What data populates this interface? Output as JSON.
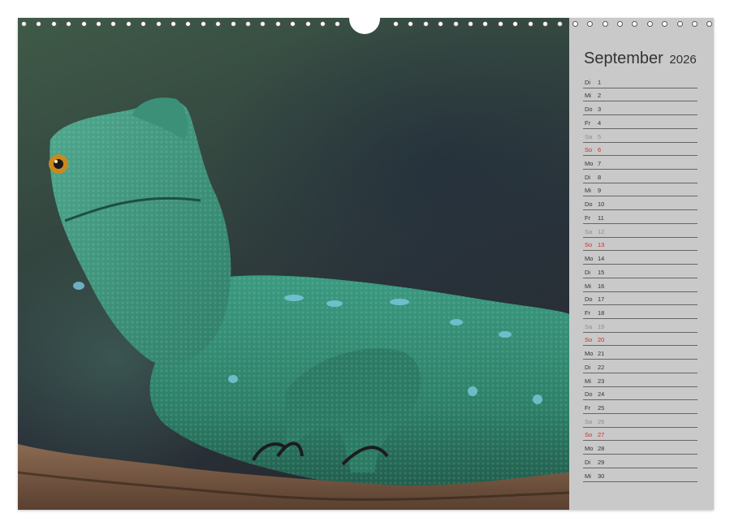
{
  "calendar": {
    "month": "September",
    "year": "2026",
    "days": [
      {
        "weekday": "Di",
        "day": "1",
        "type": "weekday"
      },
      {
        "weekday": "Mi",
        "day": "2",
        "type": "weekday"
      },
      {
        "weekday": "Do",
        "day": "3",
        "type": "weekday"
      },
      {
        "weekday": "Fr",
        "day": "4",
        "type": "weekday"
      },
      {
        "weekday": "Sa",
        "day": "5",
        "type": "sat"
      },
      {
        "weekday": "So",
        "day": "6",
        "type": "sun"
      },
      {
        "weekday": "Mo",
        "day": "7",
        "type": "weekday"
      },
      {
        "weekday": "Di",
        "day": "8",
        "type": "weekday"
      },
      {
        "weekday": "Mi",
        "day": "9",
        "type": "weekday"
      },
      {
        "weekday": "Do",
        "day": "10",
        "type": "weekday"
      },
      {
        "weekday": "Fr",
        "day": "11",
        "type": "weekday"
      },
      {
        "weekday": "Sa",
        "day": "12",
        "type": "sat"
      },
      {
        "weekday": "So",
        "day": "13",
        "type": "sun"
      },
      {
        "weekday": "Mo",
        "day": "14",
        "type": "weekday"
      },
      {
        "weekday": "Di",
        "day": "15",
        "type": "weekday"
      },
      {
        "weekday": "Mi",
        "day": "16",
        "type": "weekday"
      },
      {
        "weekday": "Do",
        "day": "17",
        "type": "weekday"
      },
      {
        "weekday": "Fr",
        "day": "18",
        "type": "weekday"
      },
      {
        "weekday": "Sa",
        "day": "19",
        "type": "sat"
      },
      {
        "weekday": "So",
        "day": "20",
        "type": "sun"
      },
      {
        "weekday": "Mo",
        "day": "21",
        "type": "weekday"
      },
      {
        "weekday": "Di",
        "day": "22",
        "type": "weekday"
      },
      {
        "weekday": "Mi",
        "day": "23",
        "type": "weekday"
      },
      {
        "weekday": "Do",
        "day": "24",
        "type": "weekday"
      },
      {
        "weekday": "Fr",
        "day": "25",
        "type": "weekday"
      },
      {
        "weekday": "Sa",
        "day": "26",
        "type": "sat"
      },
      {
        "weekday": "So",
        "day": "27",
        "type": "sun"
      },
      {
        "weekday": "Mo",
        "day": "28",
        "type": "weekday"
      },
      {
        "weekday": "Di",
        "day": "29",
        "type": "weekday"
      },
      {
        "weekday": "Mi",
        "day": "30",
        "type": "weekday"
      }
    ]
  },
  "photo": {
    "subject": "green-lizard-photo"
  },
  "colors": {
    "panel_background": "#c9c9c9",
    "sunday_text": "#d12a2a",
    "saturday_text": "#8d8d8d",
    "weekday_text": "#333333",
    "lizard_green": "#2f8a72"
  }
}
